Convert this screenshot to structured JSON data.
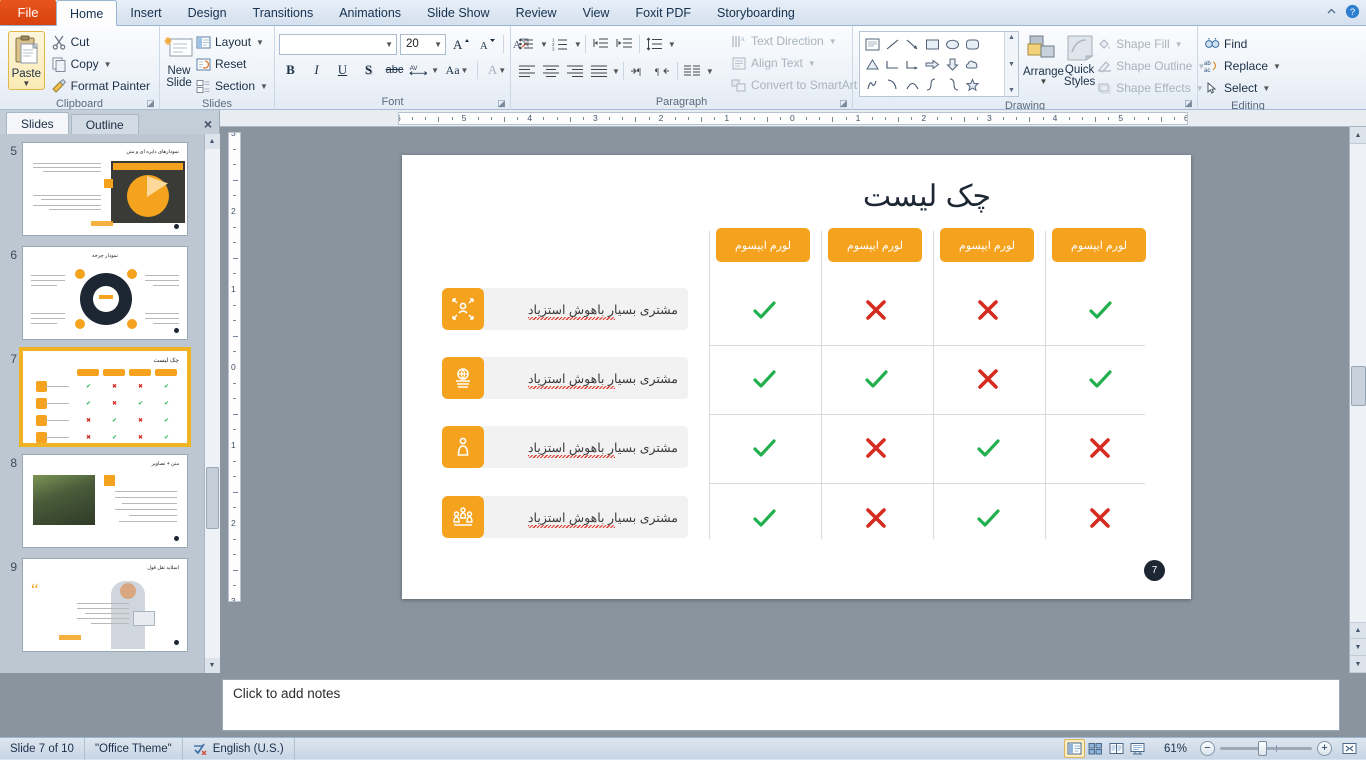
{
  "window": {
    "tabs": [
      "File",
      "Home",
      "Insert",
      "Design",
      "Transitions",
      "Animations",
      "Slide Show",
      "Review",
      "View",
      "Foxit PDF",
      "Storyboarding"
    ],
    "active_tab": "Home",
    "minimize_ribbon_icon": "chevron-up-icon",
    "help_icon": "help-icon"
  },
  "ribbon": {
    "clipboard": {
      "label": "Clipboard",
      "paste": "Paste",
      "cut": "Cut",
      "copy": "Copy",
      "format_painter": "Format Painter"
    },
    "slides": {
      "label": "Slides",
      "new_slide": "New\nSlide",
      "new_slide_l1": "New",
      "new_slide_l2": "Slide",
      "layout": "Layout",
      "reset": "Reset",
      "section": "Section"
    },
    "font": {
      "label": "Font",
      "font_name": "",
      "font_size": "20",
      "bold": "B",
      "italic": "I",
      "underline": "U",
      "shadow": "S",
      "strikethrough": "abc",
      "character_spacing": "AV",
      "change_case": "Aa",
      "font_color": "A",
      "grow_font": "A",
      "shrink_font": "A",
      "clear_formatting": "clear-formatting-icon"
    },
    "paragraph": {
      "label": "Paragraph",
      "text_direction": "Text Direction",
      "align_text": "Align Text",
      "convert_to_smartart": "Convert to SmartArt"
    },
    "drawing": {
      "label": "Drawing",
      "arrange": "Arrange",
      "quick_styles_l1": "Quick",
      "quick_styles_l2": "Styles",
      "shape_fill": "Shape Fill",
      "shape_outline": "Shape Outline",
      "shape_effects": "Shape Effects"
    },
    "editing": {
      "label": "Editing",
      "find": "Find",
      "replace": "Replace",
      "select": "Select"
    }
  },
  "left_pane": {
    "tabs": [
      "Slides",
      "Outline"
    ],
    "active_tab": "Slides",
    "close_label": "×",
    "thumbnails": [
      {
        "number": "5",
        "title": "نمودارهای دایره ای و متن",
        "kind": "pie-photo"
      },
      {
        "number": "6",
        "title": "نمودار چرخه",
        "kind": "cycle-diagram"
      },
      {
        "number": "7",
        "title": "چک لیست",
        "kind": "checklist",
        "selected": true
      },
      {
        "number": "8",
        "title": "متن + تصاویر",
        "kind": "photo-text"
      },
      {
        "number": "9",
        "title": "اسلاید نقل قول",
        "kind": "quote"
      }
    ]
  },
  "ruler": {
    "horizontal_labels": [
      "6",
      "5",
      "4",
      "3",
      "2",
      "1",
      "0",
      "1",
      "2",
      "3",
      "4",
      "5",
      "6"
    ],
    "vertical_labels": [
      "3",
      "2",
      "1",
      "0",
      "1",
      "2",
      "3"
    ]
  },
  "slide": {
    "title": "چک لیست",
    "slide_number_badge": "7",
    "column_headers": [
      "لورم ایپسوم",
      "لورم ایپسوم",
      "لورم ایپسوم",
      "لورم ایپسوم"
    ],
    "rows": [
      {
        "label": "مشتری بسیار باهوش استزیاد",
        "icon": "expand-people-icon",
        "marks": [
          "check",
          "cross",
          "cross",
          "check"
        ]
      },
      {
        "label": "مشتری بسیار باهوش استزیاد",
        "icon": "globe-building-icon",
        "marks": [
          "check",
          "check",
          "cross",
          "check"
        ]
      },
      {
        "label": "مشتری بسیار باهوش استزیاد",
        "icon": "person-icon",
        "marks": [
          "check",
          "cross",
          "check",
          "cross"
        ]
      },
      {
        "label": "مشتری بسیار باهوش استزیاد",
        "icon": "people-group-icon",
        "marks": [
          "check",
          "cross",
          "check",
          "cross"
        ]
      }
    ],
    "colors": {
      "accent_orange": "#f5a21e",
      "check_green": "#22b04f",
      "cross_red": "#d62b1f",
      "title_dark": "#1d2733"
    }
  },
  "notes": {
    "placeholder": "Click to add notes"
  },
  "status_bar": {
    "slide_counter": "Slide 7 of 10",
    "theme": "\"Office Theme\"",
    "language": "English (U.S.)",
    "spellcheck_icon": "spellcheck-icon",
    "zoom_level": "61%",
    "zoom_out": "−",
    "zoom_in": "+",
    "view_buttons": [
      "normal-view",
      "slide-sorter-view",
      "reading-view",
      "slide-show-view"
    ],
    "active_view": "normal-view",
    "fit_to_window_icon": "fit-to-window-icon"
  }
}
